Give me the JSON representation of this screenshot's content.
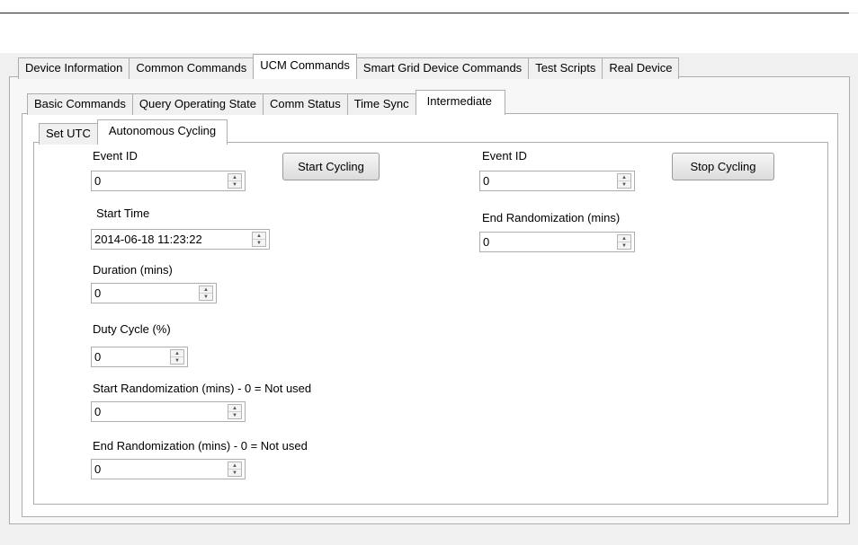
{
  "top_tabs": [
    "Device Information",
    "Common Commands",
    "UCM Commands",
    "Smart Grid Device Commands",
    "Test Scripts",
    "Real Device"
  ],
  "second_tabs": [
    "Basic Commands",
    "Query Operating State",
    "Comm Status",
    "Time Sync",
    "Intermediate"
  ],
  "third_tabs": [
    "Set UTC",
    "Autonomous Cycling"
  ],
  "start_section": {
    "event_id_label": "Event ID",
    "event_id_value": "0",
    "start_button": "Start Cycling",
    "start_time_label": "Start Time",
    "start_time_value": "2014-06-18 11:23:22",
    "duration_label": "Duration (mins)",
    "duration_value": "0",
    "duty_cycle_label": "Duty Cycle (%)",
    "duty_cycle_value": "0",
    "start_rand_label": "Start Randomization (mins) - 0 = Not used",
    "start_rand_value": "0",
    "end_rand_label": "End Randomization (mins) - 0 = Not used",
    "end_rand_value": "0"
  },
  "stop_section": {
    "event_id_label": "Event ID",
    "event_id_value": "0",
    "stop_button": "Stop Cycling",
    "end_rand_label": "End Randomization (mins)",
    "end_rand_value": "0"
  }
}
